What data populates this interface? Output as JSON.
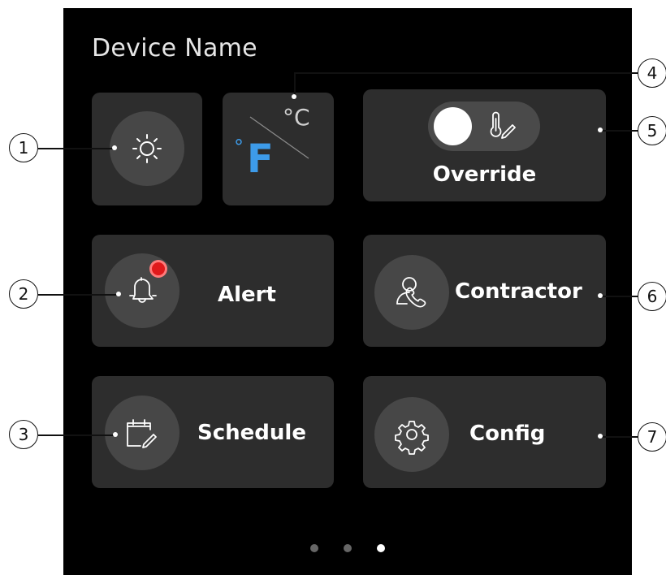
{
  "device": {
    "name": "Device Name"
  },
  "tiles": {
    "brightness": {
      "icon": "brightness-icon"
    },
    "units": {
      "active_symbol": "°",
      "active_letter": "F",
      "inactive_unit": "°C"
    },
    "override": {
      "label": "Override",
      "toggle_icon": "thermometer-edit-icon",
      "toggle_on": false
    },
    "alert": {
      "label": "Alert",
      "icon": "bell-icon",
      "badge_color": "#e0191b"
    },
    "contractor": {
      "label": "Contractor",
      "icon": "contractor-phone-icon"
    },
    "schedule": {
      "label": "Schedule",
      "icon": "calendar-edit-icon"
    },
    "config": {
      "label": "Config",
      "icon": "gear-icon"
    }
  },
  "pagination": {
    "pages": 3,
    "active_page": 3
  },
  "callouts": [
    "1",
    "2",
    "3",
    "4",
    "5",
    "6",
    "7"
  ],
  "colors": {
    "accent": "#3d9be9",
    "alert_badge": "#e0191b",
    "tile": "#2d2d2d",
    "screen": "#000000"
  }
}
